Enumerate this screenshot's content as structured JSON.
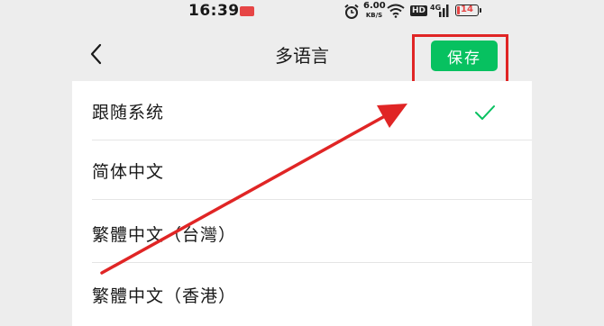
{
  "status_bar": {
    "time": "16:39",
    "network_speed": "6.00",
    "network_unit": "KB/S",
    "hd": "HD",
    "signal": "4G",
    "battery": "14",
    "battery_color": "#e64545"
  },
  "nav": {
    "back_icon": "chevron-left-icon",
    "title": "多语言",
    "save_label": "保存"
  },
  "languages": [
    {
      "label": "跟随系统",
      "selected": true
    },
    {
      "label": "简体中文",
      "selected": false
    },
    {
      "label": "繁體中文（台灣）",
      "selected": false
    },
    {
      "label": "繁體中文（香港）",
      "selected": false
    }
  ],
  "colors": {
    "accent": "#07c160",
    "annotation": "#e02525",
    "background": "#ededed"
  }
}
